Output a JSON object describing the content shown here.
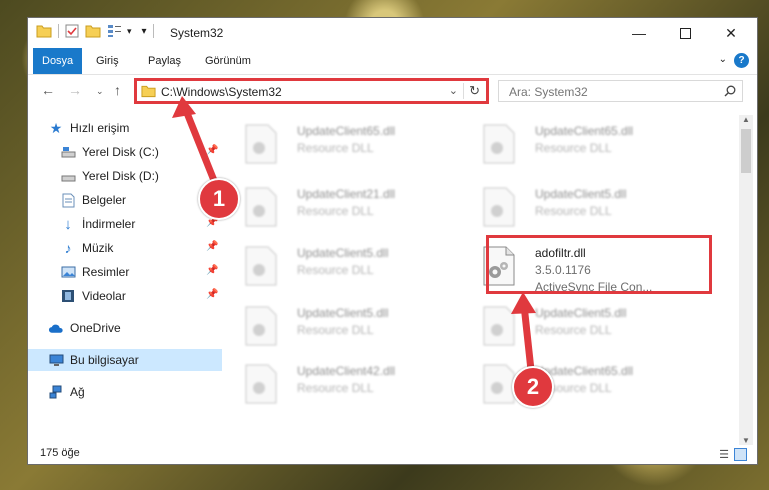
{
  "window": {
    "title": "System32"
  },
  "ribbon": {
    "tabs": [
      "Dosya",
      "Giriş",
      "Paylaş",
      "Görünüm"
    ],
    "help_label": "?"
  },
  "address": {
    "path": "C:\\Windows\\System32"
  },
  "search": {
    "placeholder": "Ara: System32"
  },
  "nav": {
    "quick_access": "Hızlı erişim",
    "items": [
      "Yerel Disk (C:)",
      "Yerel Disk (D:)",
      "Belgeler",
      "İndirmeler",
      "Müzik",
      "Resimler",
      "Videolar"
    ],
    "onedrive": "OneDrive",
    "this_pc": "Bu bilgisayar",
    "network": "Ağ"
  },
  "files": {
    "left": [
      {
        "name": "UpdateClient65.dll",
        "desc": "Resource DLL"
      },
      {
        "name": "UpdateClient21.dll",
        "desc": "Resource DLL"
      },
      {
        "name": "UpdateClient5.dll",
        "desc": "Resource DLL"
      },
      {
        "name": "UpdateClient5.dll",
        "desc": "Resource DLL"
      },
      {
        "name": "UpdateClient42.dll",
        "desc": "Resource DLL"
      }
    ],
    "right": [
      {
        "name": "UpdateClient65.dll",
        "desc": "Resource DLL"
      },
      {
        "name": "UpdateClient5.dll",
        "desc": "Resource DLL"
      },
      {
        "name": "UpdateClient5.dll",
        "desc": "Resource DLL"
      },
      {
        "name": "UpdateClient65.dll",
        "desc": "Resource DLL"
      }
    ],
    "highlighted": {
      "name": "adofiltr.dll",
      "version": "3.5.0.1176",
      "desc": "ActiveSync File Con..."
    }
  },
  "status": {
    "count": "175 öğe"
  },
  "callouts": [
    "1",
    "2"
  ],
  "colors": {
    "accent": "#1979ca",
    "highlight": "#e0393e",
    "selected": "#cce8ff"
  }
}
